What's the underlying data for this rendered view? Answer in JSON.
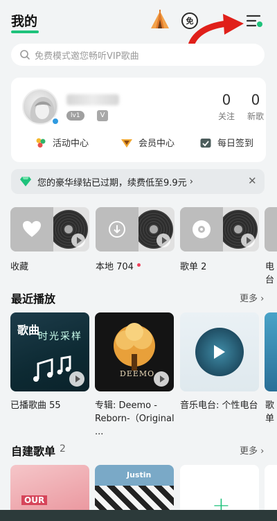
{
  "header": {
    "title": "我的",
    "free_badge": "免",
    "icons": [
      "tent-icon",
      "free-icon",
      "menu-icon"
    ]
  },
  "search": {
    "placeholder": "免费模式邀您畅听VIP歌曲"
  },
  "profile": {
    "level": "lv1",
    "stats": [
      {
        "value": "0",
        "label": "关注"
      },
      {
        "value": "0",
        "label": "新歌"
      }
    ],
    "quick_links": [
      {
        "label": "活动中心",
        "icon": "activity-icon"
      },
      {
        "label": "会员中心",
        "icon": "vip-icon"
      },
      {
        "label": "每日签到",
        "icon": "signin-icon"
      }
    ]
  },
  "banner": {
    "text": "您的豪华绿钻已过期，续费低至9.9元",
    "chevron": "›",
    "close": "✕"
  },
  "quick_access": [
    {
      "label": "收藏",
      "icon": "heart-icon"
    },
    {
      "label": "本地 704",
      "icon": "download-icon"
    },
    {
      "label": "歌单 2",
      "icon": "disc-icon"
    },
    {
      "label": "电台",
      "icon": "cloud-icon"
    }
  ],
  "recent": {
    "title": "最近播放",
    "more": "更多 ›",
    "items": [
      {
        "caption": "已播歌曲 55",
        "cover_text": "歌曲",
        "cover_sub": "时光采样"
      },
      {
        "caption": "专辑: Deemo -Reborn-（Original ...",
        "cover_text": "DEEMO"
      },
      {
        "caption": "音乐电台: 个性电台"
      },
      {
        "caption": "歌单"
      }
    ]
  },
  "mine": {
    "title": "自建歌单",
    "count": "2",
    "more": "更多 ›",
    "add": "+",
    "cover_texts": [
      "OUR",
      "Justin"
    ]
  },
  "colors": {
    "accent": "#1ec27b",
    "arrow": "#e0201a",
    "background": "#f2f4f5"
  }
}
